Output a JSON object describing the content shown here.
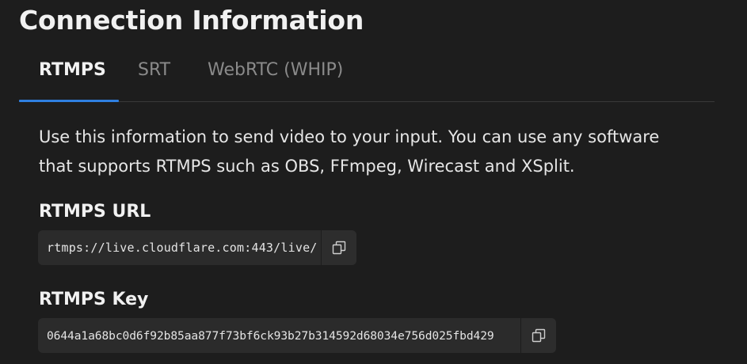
{
  "title": "Connection Information",
  "tabs": [
    {
      "label": "RTMPS",
      "active": true
    },
    {
      "label": "SRT",
      "active": false
    },
    {
      "label": "WebRTC (WHIP)",
      "active": false
    }
  ],
  "description": "Use this information to send video to your input. You can use any software that supports RTMPS such as OBS, FFmpeg, Wirecast and XSplit.",
  "fields": {
    "url": {
      "label": "RTMPS URL",
      "value": "rtmps://live.cloudflare.com:443/live/",
      "copy_icon": "copy-icon"
    },
    "key": {
      "label": "RTMPS Key",
      "value": "0644a1a68bc0d6f92b85aa877f73bf6ck93b27b314592d68034e756d025fbd429",
      "copy_icon": "copy-icon"
    }
  },
  "colors": {
    "background": "#1d1d1d",
    "accent": "#2f7fe0",
    "field_background": "#2b2b2b"
  }
}
